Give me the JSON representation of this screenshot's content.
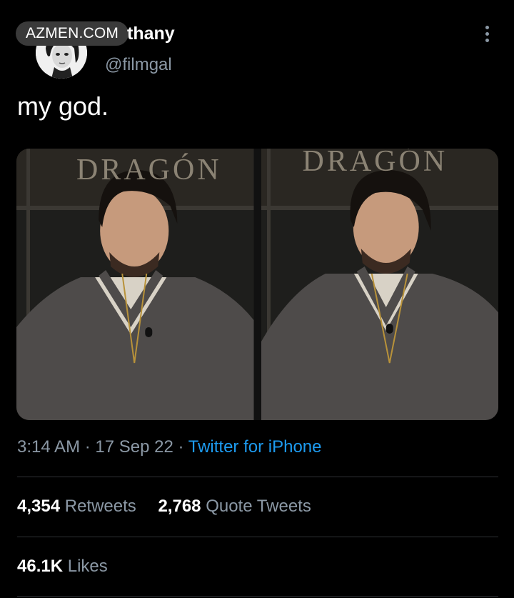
{
  "header": {
    "watermark": "AZMEN.COM",
    "display_name": "thany",
    "handle": "@filmgal"
  },
  "tweet": {
    "text": "my god."
  },
  "media": {
    "photos": [
      {
        "sign_text": "DRAGÓN"
      },
      {
        "sign_text": "DRAGÓN"
      }
    ]
  },
  "meta": {
    "time": "3:14 AM",
    "separator": "·",
    "date": "17 Sep 22",
    "source": "Twitter for iPhone"
  },
  "stats": {
    "retweets_count": "4,354",
    "retweets_label": "Retweets",
    "quotes_count": "2,768",
    "quotes_label": "Quote Tweets",
    "likes_count": "46.1K",
    "likes_label": "Likes"
  },
  "colors": {
    "background": "#000000",
    "secondary_text": "#8b98a5",
    "link": "#1d9bf0"
  }
}
